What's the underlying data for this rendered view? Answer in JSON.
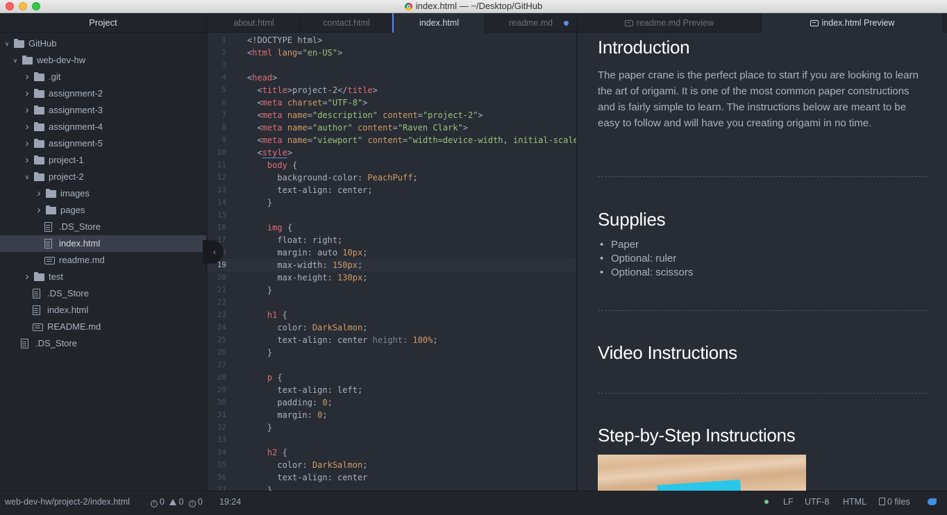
{
  "window": {
    "title": "index.html — ~/Desktop/GitHub"
  },
  "sidebar": {
    "header": "Project",
    "tree": [
      {
        "label": "GitHub",
        "type": "folder",
        "open": true,
        "depth": 0
      },
      {
        "label": "web-dev-hw",
        "type": "folder",
        "open": true,
        "depth": 1
      },
      {
        "label": ".git",
        "type": "folder",
        "open": false,
        "depth": 2
      },
      {
        "label": "assignment-2",
        "type": "folder",
        "open": false,
        "depth": 2
      },
      {
        "label": "assignment-3",
        "type": "folder",
        "open": false,
        "depth": 2
      },
      {
        "label": "assignment-4",
        "type": "folder",
        "open": false,
        "depth": 2
      },
      {
        "label": "assignment-5",
        "type": "folder",
        "open": false,
        "depth": 2
      },
      {
        "label": "project-1",
        "type": "folder",
        "open": false,
        "depth": 2
      },
      {
        "label": "project-2",
        "type": "folder",
        "open": true,
        "depth": 2
      },
      {
        "label": "images",
        "type": "folder",
        "open": false,
        "depth": 3
      },
      {
        "label": "pages",
        "type": "folder",
        "open": false,
        "depth": 3
      },
      {
        "label": ".DS_Store",
        "type": "file",
        "depth": 3
      },
      {
        "label": "index.html",
        "type": "file",
        "depth": 3,
        "selected": true
      },
      {
        "label": "readme.md",
        "type": "md",
        "depth": 3
      },
      {
        "label": "test",
        "type": "folder",
        "open": false,
        "depth": 2
      },
      {
        "label": ".DS_Store",
        "type": "file",
        "depth": 2
      },
      {
        "label": "index.html",
        "type": "file",
        "depth": 2
      },
      {
        "label": "README.md",
        "type": "md",
        "depth": 2
      },
      {
        "label": ".DS_Store",
        "type": "file",
        "depth": 1
      }
    ]
  },
  "tabs": [
    {
      "label": "about.html",
      "state": "inactive"
    },
    {
      "label": "contact.html",
      "state": "inactive"
    },
    {
      "label": "index.html",
      "state": "active"
    },
    {
      "label": "readme.md",
      "state": "modified"
    },
    {
      "label": "readme.md Preview",
      "state": "inactive",
      "icon": "markdown-icon"
    },
    {
      "label": "index.html Preview",
      "state": "active",
      "icon": "markdown-icon"
    }
  ],
  "editor": {
    "cursor_line": 19,
    "lines": [
      [
        [
          "t",
          "<!DOCTYPE html>"
        ]
      ],
      [
        [
          "p",
          "<"
        ],
        [
          "g",
          "html"
        ],
        [
          "t",
          " "
        ],
        [
          "a",
          "lang"
        ],
        [
          "p",
          "="
        ],
        [
          "s",
          "\"en-US\""
        ],
        [
          "p",
          ">"
        ]
      ],
      [],
      [
        [
          "p",
          "<"
        ],
        [
          "g",
          "head"
        ],
        [
          "p",
          ">"
        ]
      ],
      [
        [
          "t",
          "  "
        ],
        [
          "p",
          "<"
        ],
        [
          "g",
          "title"
        ],
        [
          "p",
          ">"
        ],
        [
          "t",
          "project-2"
        ],
        [
          "p",
          "</"
        ],
        [
          "g",
          "title"
        ],
        [
          "p",
          ">"
        ]
      ],
      [
        [
          "t",
          "  "
        ],
        [
          "p",
          "<"
        ],
        [
          "g",
          "meta"
        ],
        [
          "t",
          " "
        ],
        [
          "a",
          "charset"
        ],
        [
          "p",
          "="
        ],
        [
          "s",
          "\"UTF-8\""
        ],
        [
          "p",
          ">"
        ]
      ],
      [
        [
          "t",
          "  "
        ],
        [
          "p",
          "<"
        ],
        [
          "g",
          "meta"
        ],
        [
          "t",
          " "
        ],
        [
          "a",
          "name"
        ],
        [
          "p",
          "="
        ],
        [
          "s",
          "\"description\""
        ],
        [
          "t",
          " "
        ],
        [
          "a",
          "content"
        ],
        [
          "p",
          "="
        ],
        [
          "s",
          "\"project-2\""
        ],
        [
          "p",
          ">"
        ]
      ],
      [
        [
          "t",
          "  "
        ],
        [
          "p",
          "<"
        ],
        [
          "g",
          "meta"
        ],
        [
          "t",
          " "
        ],
        [
          "a",
          "name"
        ],
        [
          "p",
          "="
        ],
        [
          "s",
          "\"author\""
        ],
        [
          "t",
          " "
        ],
        [
          "a",
          "content"
        ],
        [
          "p",
          "="
        ],
        [
          "s",
          "\"Raven Clark\""
        ],
        [
          "p",
          ">"
        ]
      ],
      [
        [
          "t",
          "  "
        ],
        [
          "p",
          "<"
        ],
        [
          "g",
          "meta"
        ],
        [
          "t",
          " "
        ],
        [
          "a",
          "name"
        ],
        [
          "p",
          "="
        ],
        [
          "s",
          "\"viewport\""
        ],
        [
          "t",
          " "
        ],
        [
          "a",
          "content"
        ],
        [
          "p",
          "="
        ],
        [
          "s",
          "\"width=device-width, initial-scale"
        ]
      ],
      [
        [
          "t",
          "  "
        ],
        [
          "p",
          "<"
        ],
        [
          "u",
          "style"
        ],
        [
          "p",
          ">"
        ]
      ],
      [
        [
          "t",
          "    "
        ],
        [
          "g",
          "body"
        ],
        [
          "t",
          " {"
        ]
      ],
      [
        [
          "t",
          "      background-color: "
        ],
        [
          "n",
          "PeachPuff"
        ],
        [
          "t",
          ";"
        ]
      ],
      [
        [
          "t",
          "      text-align: center;"
        ]
      ],
      [
        [
          "t",
          "    }"
        ]
      ],
      [],
      [
        [
          "t",
          "    "
        ],
        [
          "g",
          "img"
        ],
        [
          "t",
          " {"
        ]
      ],
      [
        [
          "t",
          "      float: right;"
        ]
      ],
      [
        [
          "t",
          "      margin: auto "
        ],
        [
          "n",
          "10px"
        ],
        [
          "t",
          ";"
        ]
      ],
      [
        [
          "t",
          "      max-width: "
        ],
        [
          "n",
          "150px"
        ],
        [
          "t",
          ";"
        ]
      ],
      [
        [
          "t",
          "      max-height: "
        ],
        [
          "n",
          "130px"
        ],
        [
          "t",
          ";"
        ]
      ],
      [
        [
          "t",
          "    }"
        ]
      ],
      [],
      [
        [
          "t",
          "    "
        ],
        [
          "g",
          "h1"
        ],
        [
          "t",
          " {"
        ]
      ],
      [
        [
          "t",
          "      color: "
        ],
        [
          "n",
          "DarkSalmon"
        ],
        [
          "t",
          ";"
        ]
      ],
      [
        [
          "t",
          "      text-align: center "
        ],
        [
          "d",
          "height: "
        ],
        [
          "n",
          "100%"
        ],
        [
          "t",
          ";"
        ]
      ],
      [
        [
          "t",
          "    }"
        ]
      ],
      [],
      [
        [
          "t",
          "    "
        ],
        [
          "g",
          "p"
        ],
        [
          "t",
          " {"
        ]
      ],
      [
        [
          "t",
          "      text-align: left;"
        ]
      ],
      [
        [
          "t",
          "      padding: "
        ],
        [
          "n",
          "0"
        ],
        [
          "t",
          ";"
        ]
      ],
      [
        [
          "t",
          "      margin: "
        ],
        [
          "n",
          "0"
        ],
        [
          "t",
          ";"
        ]
      ],
      [
        [
          "t",
          "    }"
        ]
      ],
      [],
      [
        [
          "t",
          "    "
        ],
        [
          "g",
          "h2"
        ],
        [
          "t",
          " {"
        ]
      ],
      [
        [
          "t",
          "      color: "
        ],
        [
          "n",
          "DarkSalmon"
        ],
        [
          "t",
          ";"
        ]
      ],
      [
        [
          "t",
          "      text-align: center"
        ]
      ],
      [
        [
          "t",
          "    }"
        ]
      ]
    ]
  },
  "preview": {
    "intro_heading": "Introduction",
    "intro_text": "The paper crane is the perfect place to start if you are looking to learn the art of origami. It is one of the most common paper constructions and is fairly simple to learn. The instructions below are meant to be easy to follow and will have you creating origami in no time.",
    "supplies_heading": "Supplies",
    "supplies": [
      "Paper",
      "Optional: ruler",
      "Optional: scissors"
    ],
    "video_heading": "Video Instructions",
    "steps_heading": "Step-by-Step Instructions"
  },
  "statusbar": {
    "path": "web-dev-hw/project-2/index.html",
    "errors": "0",
    "warnings": "0",
    "infos": "0",
    "cursor": "19:24",
    "line_ending": "LF",
    "encoding": "UTF-8",
    "grammar": "HTML",
    "files": "0 files"
  },
  "colors": {
    "accent": "#568af2",
    "tag": "#e06c75",
    "attribute": "#d19a66",
    "string": "#98c379",
    "background": "#282c34"
  }
}
